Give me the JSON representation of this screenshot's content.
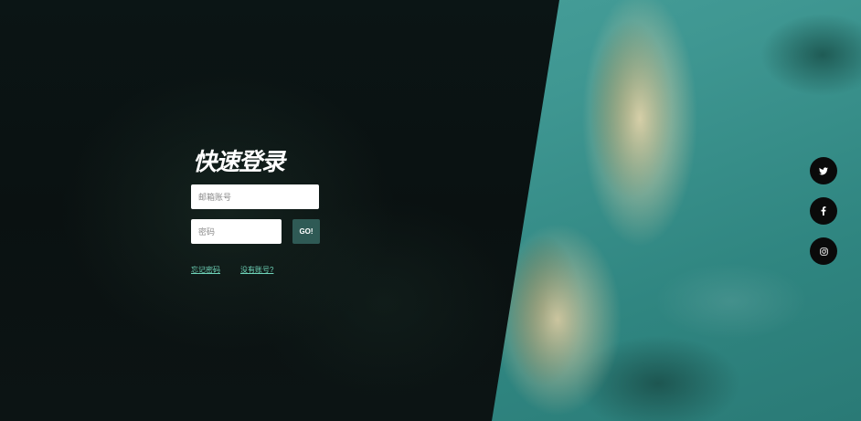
{
  "login": {
    "title": "快速登录",
    "email_placeholder": "邮箱账号",
    "password_placeholder": "密码",
    "submit_label": "GO!",
    "forgot_password_link": "忘记密码",
    "register_link": "没有账号?"
  },
  "social": {
    "items": [
      {
        "icon": "twitter-icon"
      },
      {
        "icon": "facebook-icon"
      },
      {
        "icon": "instagram-icon"
      }
    ]
  },
  "colors": {
    "panel_dark": "#0a1212",
    "accent_button": "#2f5a55",
    "link": "#6fd3b8",
    "sea": "#3f9792"
  }
}
